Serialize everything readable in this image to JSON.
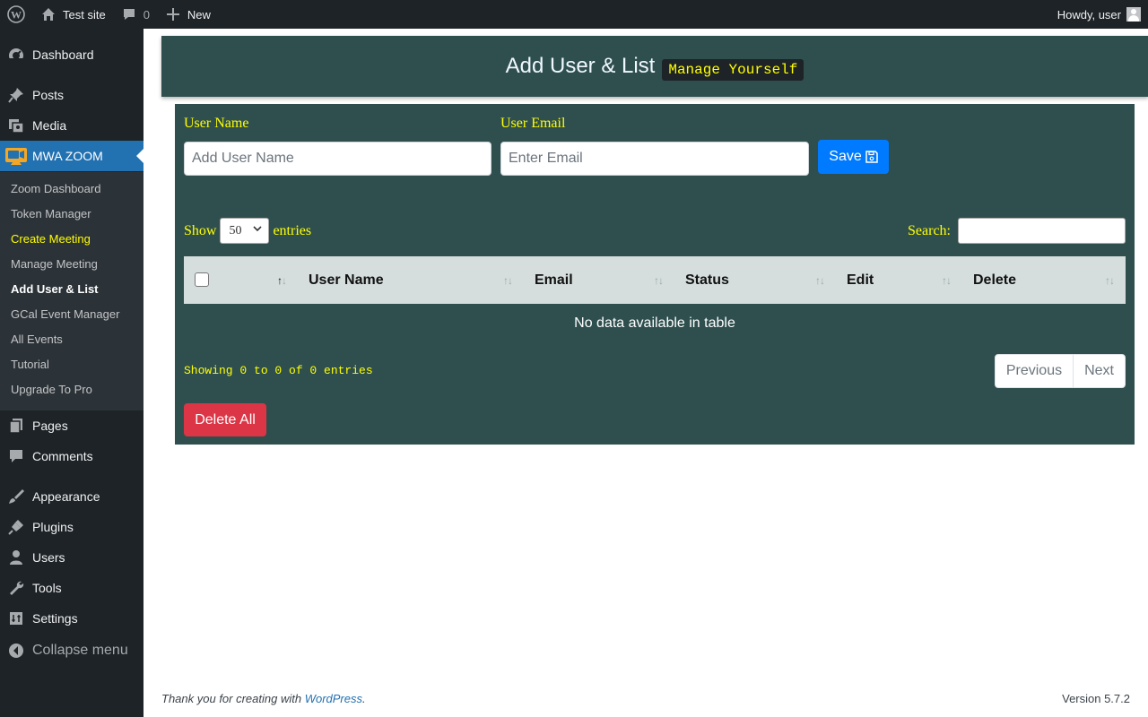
{
  "adminbar": {
    "site_name": "Test site",
    "comments_count": "0",
    "new_label": "New",
    "greeting": "Howdy, user"
  },
  "sidebar": {
    "items": [
      {
        "label": "Dashboard",
        "icon": "dashboard-icon"
      },
      {
        "label": "Posts",
        "icon": "pin-icon"
      },
      {
        "label": "Media",
        "icon": "media-icon"
      },
      {
        "label": "MWA ZOOM",
        "icon": "zoom-video-icon"
      },
      {
        "label": "Pages",
        "icon": "pages-icon"
      },
      {
        "label": "Comments",
        "icon": "comment-icon"
      },
      {
        "label": "Appearance",
        "icon": "brush-icon"
      },
      {
        "label": "Plugins",
        "icon": "plug-icon"
      },
      {
        "label": "Users",
        "icon": "user-icon"
      },
      {
        "label": "Tools",
        "icon": "wrench-icon"
      },
      {
        "label": "Settings",
        "icon": "settings-icon"
      },
      {
        "label": "Collapse menu",
        "icon": "collapse-icon"
      }
    ],
    "submenu": [
      "Zoom Dashboard",
      "Token Manager",
      "Create Meeting",
      "Manage Meeting",
      "Add User & List",
      "GCal Event Manager",
      "All Events",
      "Tutorial",
      "Upgrade To Pro"
    ]
  },
  "header": {
    "title": "Add User & List",
    "tag": "Manage Yourself"
  },
  "form": {
    "username_label": "User Name",
    "username_placeholder": "Add User Name",
    "email_label": "User Email",
    "email_placeholder": "Enter Email",
    "save_label": "Save"
  },
  "table": {
    "show_label": "Show",
    "entries_value": "50",
    "entries_label": "entries",
    "search_label": "Search:",
    "columns": [
      "User Name",
      "Email",
      "Status",
      "Edit",
      "Delete"
    ],
    "empty_text": "No data available in table",
    "info": "Showing 0 to 0 of 0 entries",
    "prev_label": "Previous",
    "next_label": "Next",
    "delete_all_label": "Delete All"
  },
  "footer": {
    "thanks_prefix": "Thank you for creating with ",
    "thanks_link": "WordPress",
    "thanks_suffix": ".",
    "version": "Version 5.7.2"
  },
  "colors": {
    "panel": "#2f4f4f",
    "accent_text": "#ffff00",
    "primary": "#007bff",
    "danger": "#dc3545",
    "wp_dark": "#1d2327",
    "wp_blue": "#2271b1"
  }
}
